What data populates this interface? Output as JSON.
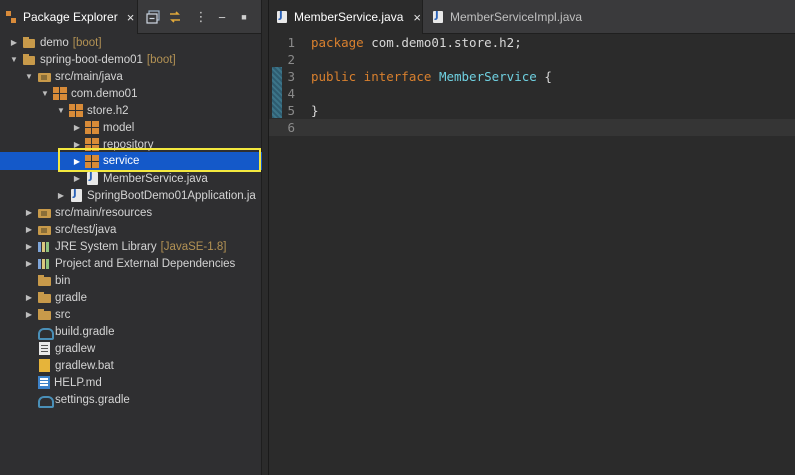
{
  "package_explorer": {
    "tab_label": "Package Explorer",
    "close_glyph": "×",
    "toolbar": {
      "collapse_all_icon": "collapse-all-icon",
      "link_editor_icon": "link-with-editor-icon",
      "view_menu_glyph": "⋮",
      "minimize_glyph": "−",
      "maximize_glyph": "■"
    },
    "tree": [
      {
        "label": "demo",
        "extra": "[boot]",
        "icon": "project-icon",
        "twisty": "▶",
        "selected": false
      },
      {
        "label": "spring-boot-demo01",
        "extra": "[boot]",
        "icon": "project-icon",
        "twisty": "▼",
        "selected": false
      },
      {
        "label": "src/main/java",
        "extra": "",
        "icon": "source-folder-icon",
        "twisty": "▼",
        "selected": false
      },
      {
        "label": "com.demo01",
        "extra": "",
        "icon": "package-icon",
        "twisty": "▼",
        "selected": false
      },
      {
        "label": "store.h2",
        "extra": "",
        "icon": "package-icon",
        "twisty": "▼",
        "selected": false
      },
      {
        "label": "model",
        "extra": "",
        "icon": "package-icon",
        "twisty": "▶",
        "selected": false
      },
      {
        "label": "repository",
        "extra": "",
        "icon": "package-icon",
        "twisty": "▶",
        "selected": false
      },
      {
        "label": "service",
        "extra": "",
        "icon": "package-icon",
        "twisty": "▶",
        "selected": true
      },
      {
        "label": "MemberService.java",
        "extra": "",
        "icon": "java-file-icon",
        "twisty": "▶",
        "selected": false
      },
      {
        "label": "SpringBootDemo01Application.ja",
        "extra": "",
        "icon": "java-file-icon",
        "twisty": "▶",
        "selected": false
      },
      {
        "label": "src/main/resources",
        "extra": "",
        "icon": "source-folder-icon",
        "twisty": "▶",
        "selected": false
      },
      {
        "label": "src/test/java",
        "extra": "",
        "icon": "source-folder-icon",
        "twisty": "▶",
        "selected": false
      },
      {
        "label": "JRE System Library",
        "extra": "[JavaSE-1.8]",
        "icon": "library-icon",
        "twisty": "▶",
        "selected": false
      },
      {
        "label": "Project and External Dependencies",
        "extra": "",
        "icon": "library-icon",
        "twisty": "▶",
        "selected": false
      },
      {
        "label": "bin",
        "extra": "",
        "icon": "folder-icon",
        "twisty": "",
        "selected": false
      },
      {
        "label": "gradle",
        "extra": "",
        "icon": "folder-icon",
        "twisty": "▶",
        "selected": false
      },
      {
        "label": "src",
        "extra": "",
        "icon": "folder-icon",
        "twisty": "▶",
        "selected": false
      },
      {
        "label": "build.gradle",
        "extra": "",
        "icon": "gradle-file-icon",
        "twisty": "",
        "selected": false
      },
      {
        "label": "gradlew",
        "extra": "",
        "icon": "text-file-icon",
        "twisty": "",
        "selected": false
      },
      {
        "label": "gradlew.bat",
        "extra": "",
        "icon": "bat-file-icon",
        "twisty": "",
        "selected": false
      },
      {
        "label": "HELP.md",
        "extra": "",
        "icon": "markdown-file-icon",
        "twisty": "",
        "selected": false
      },
      {
        "label": "settings.gradle",
        "extra": "",
        "icon": "gradle-file-icon",
        "twisty": "",
        "selected": false
      }
    ]
  },
  "editor": {
    "tabs": [
      {
        "label": "MemberService.java",
        "active": true,
        "close_glyph": "×"
      },
      {
        "label": "MemberServiceImpl.java",
        "active": false
      }
    ],
    "lines": [
      {
        "num": "1",
        "kw": "package",
        "rest": " com.demo01.store.h2;"
      },
      {
        "num": "2",
        "kw": "",
        "rest": ""
      },
      {
        "num": "3",
        "kw": "public interface",
        "type": "MemberService",
        "rest": " {"
      },
      {
        "num": "4",
        "kw": "",
        "rest": ""
      },
      {
        "num": "5",
        "kw": "",
        "rest": "}"
      },
      {
        "num": "6",
        "kw": "",
        "rest": ""
      }
    ]
  }
}
